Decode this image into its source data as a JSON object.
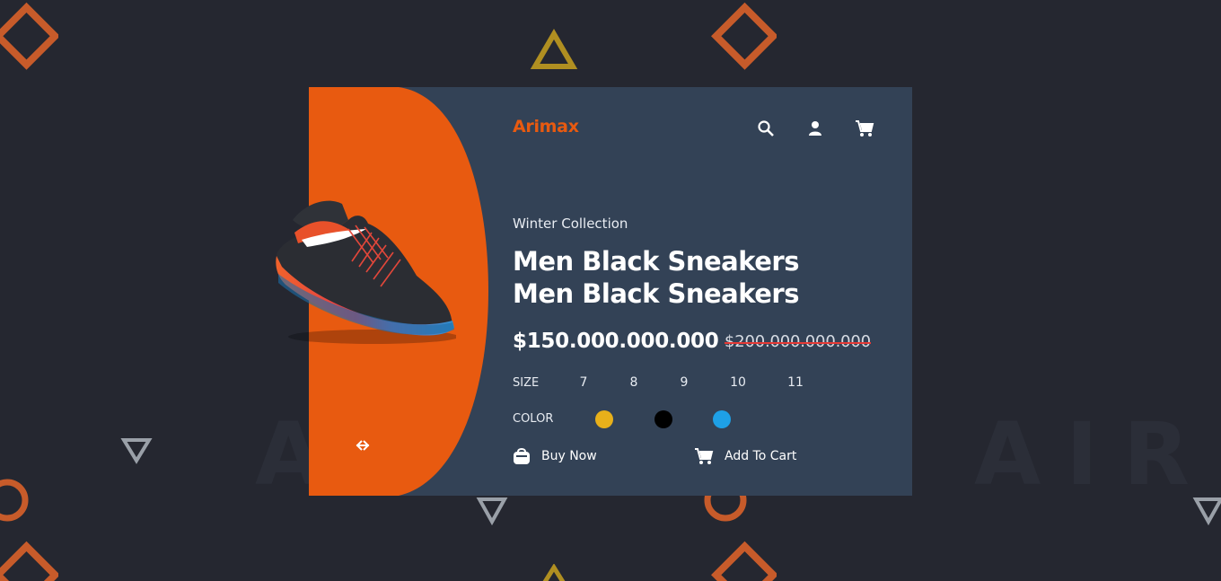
{
  "brand": {
    "name": "Arimax",
    "accent_color": "#e85a10"
  },
  "background": {
    "watermark_left": "A",
    "watermark_right": "AIRM"
  },
  "header": {
    "icons": [
      "search-icon",
      "user-icon",
      "cart-icon"
    ]
  },
  "product": {
    "collection": "Winter Collection",
    "title": "Men Black Sneakers Men Black Sneakers",
    "price": "$150.000.000.000",
    "old_price": "$200.000.000.000",
    "size_label": "SIZE",
    "sizes": [
      "7",
      "8",
      "9",
      "10",
      "11"
    ],
    "color_label": "COLOR",
    "colors": [
      "#e8b01a",
      "#000000",
      "#1ea0e6"
    ]
  },
  "carousel": {
    "prev_icon": "arrow-left-icon",
    "next_icon": "arrow-right-icon"
  },
  "actions": {
    "buy_now": "Buy Now",
    "add_to_cart": "Add To Cart"
  },
  "colors": {
    "page_bg": "#252730",
    "card_bg": "#334256",
    "orange": "#e85a10"
  }
}
